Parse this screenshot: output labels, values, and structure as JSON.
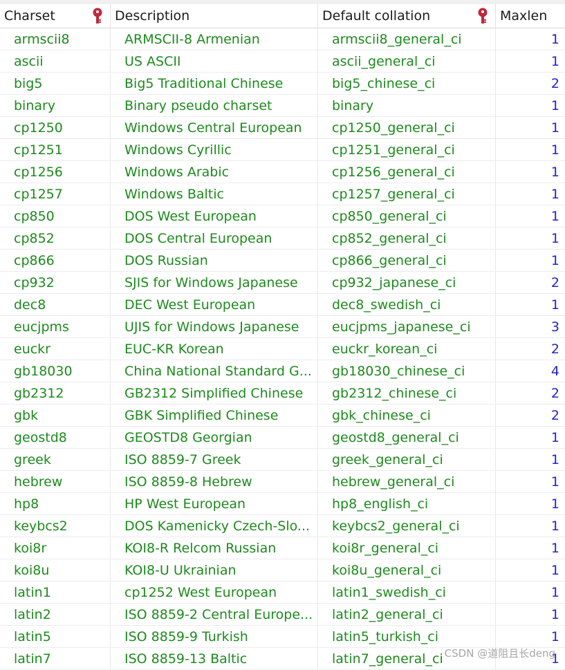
{
  "columns": {
    "charset": "Charset",
    "description": "Description",
    "default_collation": "Default collation",
    "maxlen": "Maxlen"
  },
  "rows": [
    {
      "charset": "armscii8",
      "description": "ARMSCII-8 Armenian",
      "collation": "armscii8_general_ci",
      "maxlen": "1"
    },
    {
      "charset": "ascii",
      "description": "US ASCII",
      "collation": "ascii_general_ci",
      "maxlen": "1"
    },
    {
      "charset": "big5",
      "description": "Big5 Traditional Chinese",
      "collation": "big5_chinese_ci",
      "maxlen": "2"
    },
    {
      "charset": "binary",
      "description": "Binary pseudo charset",
      "collation": "binary",
      "maxlen": "1"
    },
    {
      "charset": "cp1250",
      "description": "Windows Central European",
      "collation": "cp1250_general_ci",
      "maxlen": "1"
    },
    {
      "charset": "cp1251",
      "description": "Windows Cyrillic",
      "collation": "cp1251_general_ci",
      "maxlen": "1"
    },
    {
      "charset": "cp1256",
      "description": "Windows Arabic",
      "collation": "cp1256_general_ci",
      "maxlen": "1"
    },
    {
      "charset": "cp1257",
      "description": "Windows Baltic",
      "collation": "cp1257_general_ci",
      "maxlen": "1"
    },
    {
      "charset": "cp850",
      "description": "DOS West European",
      "collation": "cp850_general_ci",
      "maxlen": "1"
    },
    {
      "charset": "cp852",
      "description": "DOS Central European",
      "collation": "cp852_general_ci",
      "maxlen": "1"
    },
    {
      "charset": "cp866",
      "description": "DOS Russian",
      "collation": "cp866_general_ci",
      "maxlen": "1"
    },
    {
      "charset": "cp932",
      "description": "SJIS for Windows Japanese",
      "collation": "cp932_japanese_ci",
      "maxlen": "2"
    },
    {
      "charset": "dec8",
      "description": "DEC West European",
      "collation": "dec8_swedish_ci",
      "maxlen": "1"
    },
    {
      "charset": "eucjpms",
      "description": "UJIS for Windows Japanese",
      "collation": "eucjpms_japanese_ci",
      "maxlen": "3"
    },
    {
      "charset": "euckr",
      "description": "EUC-KR Korean",
      "collation": "euckr_korean_ci",
      "maxlen": "2"
    },
    {
      "charset": "gb18030",
      "description": "China National Standard G...",
      "collation": "gb18030_chinese_ci",
      "maxlen": "4"
    },
    {
      "charset": "gb2312",
      "description": "GB2312 Simplified Chinese",
      "collation": "gb2312_chinese_ci",
      "maxlen": "2"
    },
    {
      "charset": "gbk",
      "description": "GBK Simplified Chinese",
      "collation": "gbk_chinese_ci",
      "maxlen": "2"
    },
    {
      "charset": "geostd8",
      "description": "GEOSTD8 Georgian",
      "collation": "geostd8_general_ci",
      "maxlen": "1"
    },
    {
      "charset": "greek",
      "description": "ISO 8859-7 Greek",
      "collation": "greek_general_ci",
      "maxlen": "1"
    },
    {
      "charset": "hebrew",
      "description": "ISO 8859-8 Hebrew",
      "collation": "hebrew_general_ci",
      "maxlen": "1"
    },
    {
      "charset": "hp8",
      "description": "HP West European",
      "collation": "hp8_english_ci",
      "maxlen": "1"
    },
    {
      "charset": "keybcs2",
      "description": "DOS Kamenicky Czech-Slo...",
      "collation": "keybcs2_general_ci",
      "maxlen": "1"
    },
    {
      "charset": "koi8r",
      "description": "KOI8-R Relcom Russian",
      "collation": "koi8r_general_ci",
      "maxlen": "1"
    },
    {
      "charset": "koi8u",
      "description": "KOI8-U Ukrainian",
      "collation": "koi8u_general_ci",
      "maxlen": "1"
    },
    {
      "charset": "latin1",
      "description": "cp1252 West European",
      "collation": "latin1_swedish_ci",
      "maxlen": "1"
    },
    {
      "charset": "latin2",
      "description": "ISO 8859-2 Central Europe...",
      "collation": "latin2_general_ci",
      "maxlen": "1"
    },
    {
      "charset": "latin5",
      "description": "ISO 8859-9 Turkish",
      "collation": "latin5_turkish_ci",
      "maxlen": "1"
    },
    {
      "charset": "latin7",
      "description": "ISO 8859-13 Baltic",
      "collation": "latin7_general_ci",
      "maxlen": "1"
    }
  ],
  "watermark": "CSDN @道阻且长deng",
  "icons": {
    "primary_key": "key-icon"
  },
  "colors": {
    "text_cell": "#1d8a1d",
    "number_cell": "#2222cc",
    "key_icon": "#c0283a"
  }
}
